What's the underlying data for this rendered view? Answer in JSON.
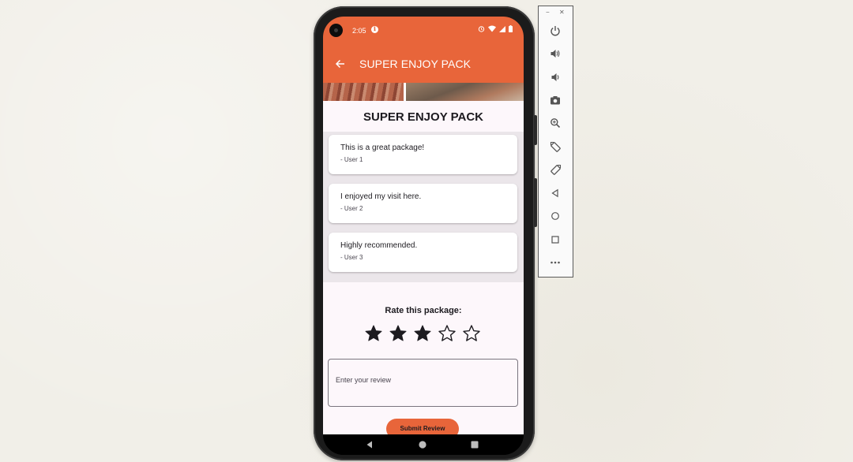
{
  "status_bar": {
    "time": "2:05",
    "notification_icon": "app-notification-icon",
    "icons": [
      "alarm-icon",
      "wifi-icon",
      "signal-icon",
      "battery-icon"
    ]
  },
  "app_bar": {
    "title": "SUPER ENJOY PACK",
    "back_icon": "arrow-back-icon"
  },
  "package": {
    "title": "SUPER ENJOY PACK"
  },
  "reviews": [
    {
      "text": "This is a great package!",
      "user": "- User 1"
    },
    {
      "text": "I enjoyed my visit here.",
      "user": "- User 2"
    },
    {
      "text": "Highly recommended.",
      "user": "- User 3"
    }
  ],
  "rating": {
    "label": "Rate this package:",
    "value": 3,
    "max": 5
  },
  "review_input": {
    "placeholder": "Enter your review",
    "value": ""
  },
  "submit": {
    "label": "Submit Review"
  },
  "colors": {
    "primary": "#e8653a",
    "surface": "#fdf7fb",
    "review_section_bg": "#ebe6ea",
    "text": "#1d1b20"
  },
  "system_nav": [
    "back-icon",
    "home-icon",
    "recents-icon"
  ],
  "emulator_controls": {
    "window": [
      "minimize-icon",
      "close-icon"
    ],
    "buttons": [
      "power-icon",
      "volume-up-icon",
      "volume-down-icon",
      "camera-icon",
      "zoom-icon",
      "rotate-left-icon",
      "rotate-right-icon",
      "back-icon",
      "home-icon",
      "overview-icon",
      "more-icon"
    ]
  }
}
